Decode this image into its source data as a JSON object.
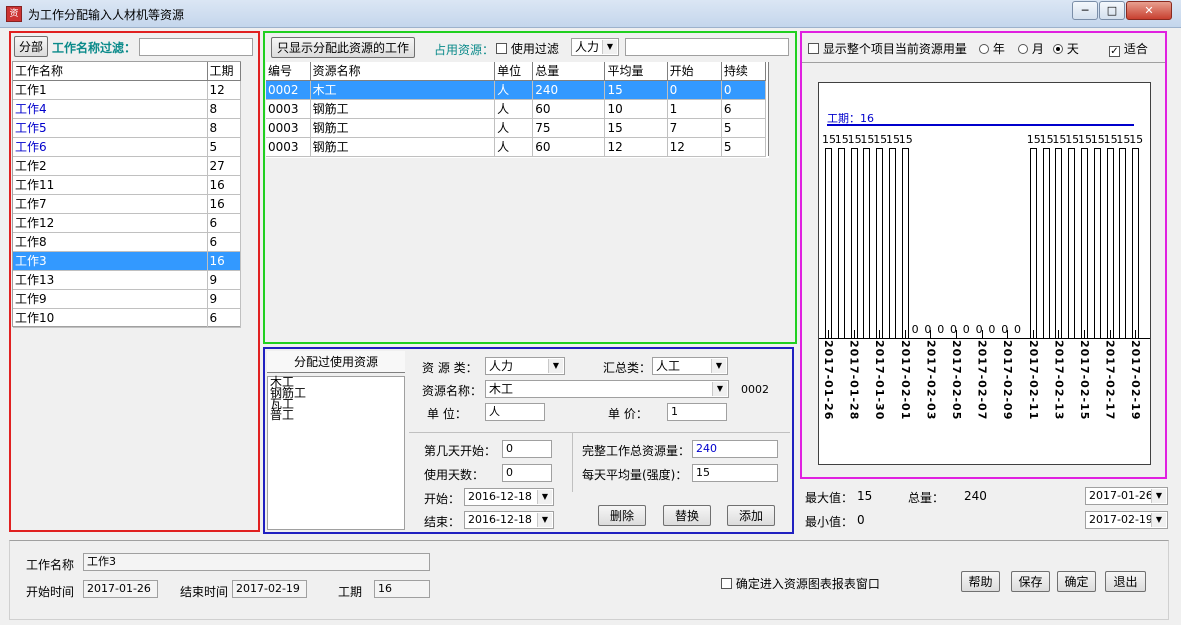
{
  "window": {
    "title": "为工作分配输入人材机等资源",
    "app_icon": "app-icon",
    "buttons": [
      "─",
      "□",
      "✕"
    ]
  },
  "left": {
    "tab": "分部",
    "filter_label": "工作名称过滤：",
    "filter_value": "",
    "columns": [
      "工作名称",
      "工期"
    ],
    "rows": [
      {
        "name": "工作1",
        "days": "12",
        "color": "#000"
      },
      {
        "name": "工作4",
        "days": "8",
        "color": "#0000cc"
      },
      {
        "name": "工作5",
        "days": "8",
        "color": "#0000cc"
      },
      {
        "name": "工作6",
        "days": "5",
        "color": "#0000cc"
      },
      {
        "name": "工作2",
        "days": "27",
        "color": "#000"
      },
      {
        "name": "工作11",
        "days": "16",
        "color": "#000"
      },
      {
        "name": "工作7",
        "days": "16",
        "color": "#000"
      },
      {
        "name": "工作12",
        "days": "6",
        "color": "#000"
      },
      {
        "name": "工作8",
        "days": "6",
        "color": "#000"
      },
      {
        "name": "工作3",
        "days": "16",
        "color": "#fff",
        "selected": true
      },
      {
        "name": "工作13",
        "days": "9",
        "color": "#000"
      },
      {
        "name": "工作9",
        "days": "9",
        "color": "#000"
      },
      {
        "name": "工作10",
        "days": "6",
        "color": "#000"
      }
    ]
  },
  "mid": {
    "show_only_btn": "只显示分配此资源的工作",
    "occupy_label": "占用资源：",
    "use_filter_label": "使用过滤",
    "use_filter_checked": false,
    "type_select": "人力",
    "filter_value": "",
    "columns": [
      "编号",
      "资源名称",
      "单位",
      "总量",
      "平均量",
      "开始",
      "持续"
    ],
    "rows": [
      [
        "0002",
        "木工",
        "人",
        "240",
        "15",
        "0",
        "0"
      ],
      [
        "0003",
        "钢筋工",
        "人",
        "60",
        "10",
        "1",
        "6"
      ],
      [
        "0003",
        "钢筋工",
        "人",
        "75",
        "15",
        "7",
        "5"
      ],
      [
        "0003",
        "钢筋工",
        "人",
        "60",
        "12",
        "12",
        "5"
      ]
    ],
    "selected_row": 0
  },
  "assigned": {
    "header": "分配过使用资源",
    "items": [
      "木工",
      "钢筋工",
      "瓦工",
      "普工"
    ]
  },
  "detail": {
    "res_type_label": "资 源 类：",
    "res_type": "人力",
    "sum_type_label": "汇总类：",
    "sum_type": "人工",
    "res_name_label": "资源名称：",
    "res_name": "木工",
    "res_code": "0002",
    "unit_label": "单   位：",
    "unit": "人",
    "price_label": "单   价：",
    "price": "1",
    "start_day_label": "第几天开始：",
    "start_day": "0",
    "use_days_label": "使用天数：",
    "use_days": "0",
    "start_label": "开始：",
    "start_date": "2016-12-18",
    "end_label": "结束：",
    "end_date": "2016-12-18",
    "total_label": "完整工作总资源量：",
    "total": "240",
    "avg_label": "每天平均量(强度)：",
    "avg": "15",
    "delete_btn": "删除",
    "replace_btn": "替换",
    "add_btn": "添加"
  },
  "chart_opts": {
    "show_all_label": "显示整个项目当前资源用量",
    "year": "年",
    "month": "月",
    "day": "天",
    "selected": "天",
    "fit_label": "适合",
    "fit_checked": true
  },
  "chart_data": {
    "type": "bar",
    "title": "工期：16",
    "categories": [
      "2017-01-26",
      "2017-01-27",
      "2017-01-28",
      "2017-01-29",
      "2017-01-30",
      "2017-01-31",
      "2017-02-01",
      "2017-02-02",
      "2017-02-03",
      "2017-02-04",
      "2017-02-05",
      "2017-02-06",
      "2017-02-07",
      "2017-02-08",
      "2017-02-09",
      "2017-02-10",
      "2017-02-11",
      "2017-02-12",
      "2017-02-13",
      "2017-02-14",
      "2017-02-15",
      "2017-02-16",
      "2017-02-17",
      "2017-02-18",
      "2017-02-19"
    ],
    "tick_labels": [
      "2017-01-26",
      "2017-01-28",
      "2017-01-30",
      "2017-02-01",
      "2017-02-03",
      "2017-02-05",
      "2017-02-07",
      "2017-02-09",
      "2017-02-11",
      "2017-02-13",
      "2017-02-15",
      "2017-02-17",
      "2017-02-19"
    ],
    "values": [
      15,
      15,
      15,
      15,
      15,
      15,
      15,
      0,
      0,
      0,
      0,
      0,
      0,
      0,
      0,
      0,
      15,
      15,
      15,
      15,
      15,
      15,
      15,
      15,
      15
    ],
    "ylim": [
      0,
      15
    ]
  },
  "stats": {
    "max_label": "最大值：",
    "max": "15",
    "total_label": "总量：",
    "total": "240",
    "min_label": "最小值：",
    "min": "0",
    "from_date": "2017-01-26",
    "to_date": "2017-02-19"
  },
  "footer": {
    "name_label": "工作名称",
    "name": "工作3",
    "start_label": "开始时间",
    "start": "2017-01-26",
    "end_label": "结束时间",
    "end": "2017-02-19",
    "dur_label": "工期",
    "dur": "16",
    "confirm_label": "确定进入资源图表报表窗口",
    "help": "帮助",
    "save": "保存",
    "ok": "确定",
    "exit": "退出"
  },
  "colors": {
    "left_frame": "#e02020",
    "mid_frame": "#20d020",
    "detail_frame": "#2020c0",
    "chart_frame": "#e020e0",
    "selection": "#3399ff"
  }
}
